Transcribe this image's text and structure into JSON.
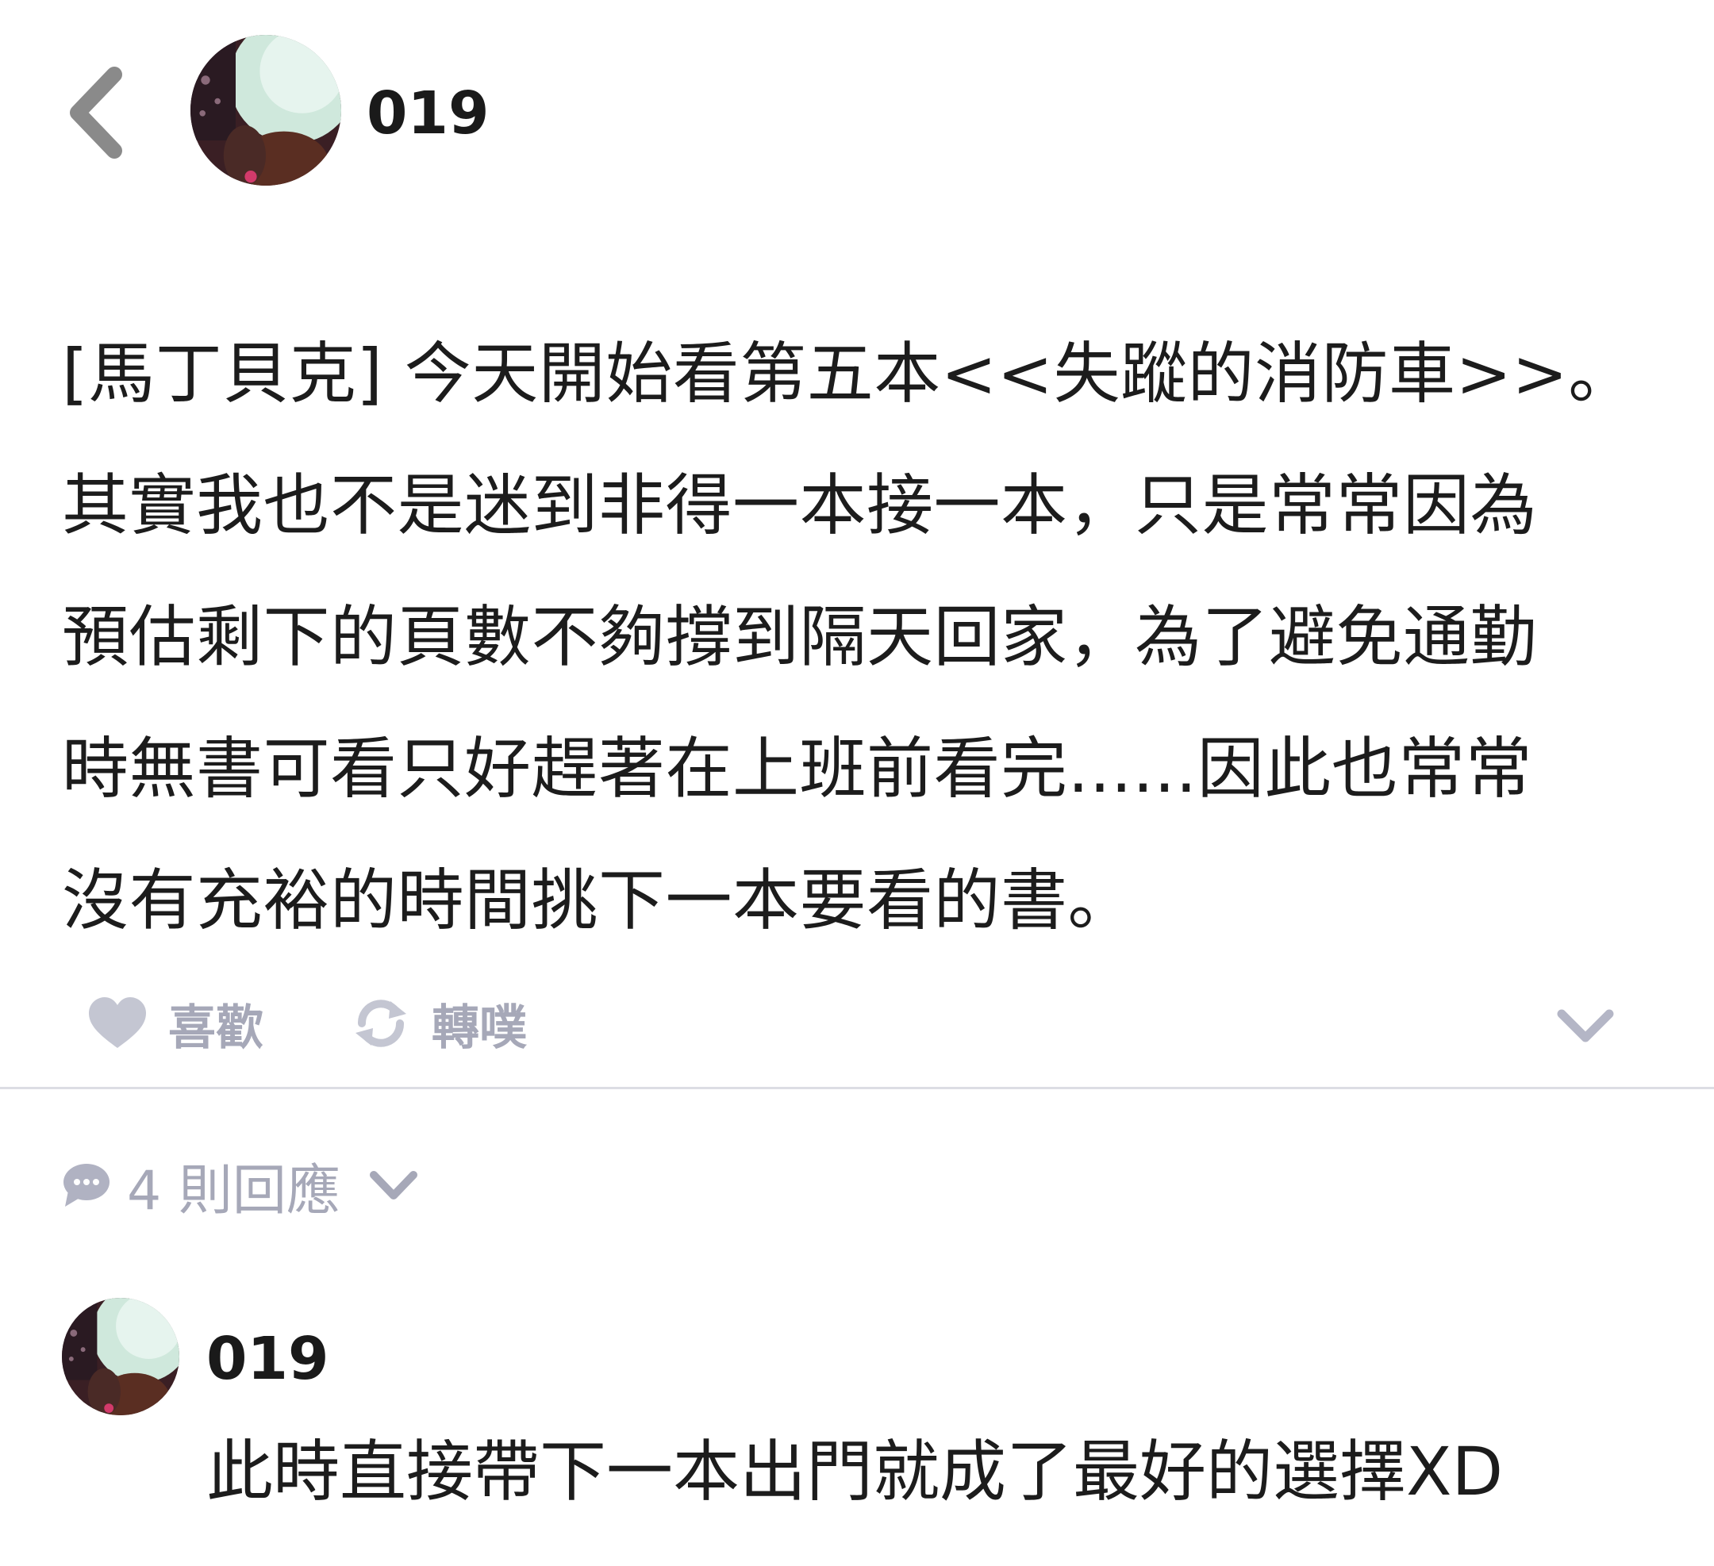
{
  "header": {
    "username": "019"
  },
  "post": {
    "lines": [
      "[馬丁貝克] 今天開始看第五本<<失蹤的消防車>>。",
      "其實我也不是迷到非得一本接一本，只是常常因為",
      "預估剩下的頁數不夠撐到隔天回家，為了避免通勤",
      "時無書可看只好趕著在上班前看完......因此也常常",
      "沒有充裕的時間挑下一本要看的書。"
    ]
  },
  "actions": {
    "like_label": "喜歡",
    "replurk_label": "轉噗"
  },
  "responses": {
    "label": "4 則回應"
  },
  "comment": {
    "username": "019",
    "text": "此時直接帶下一本出門就成了最好的選擇XD"
  },
  "colors": {
    "action_gray": "#a6a8b8",
    "text": "#1c1c1c",
    "divider": "#dcdde4"
  },
  "icons": [
    "back-icon",
    "heart-icon",
    "replurk-icon",
    "chevron-down-icon",
    "speech-bubble-icon"
  ]
}
